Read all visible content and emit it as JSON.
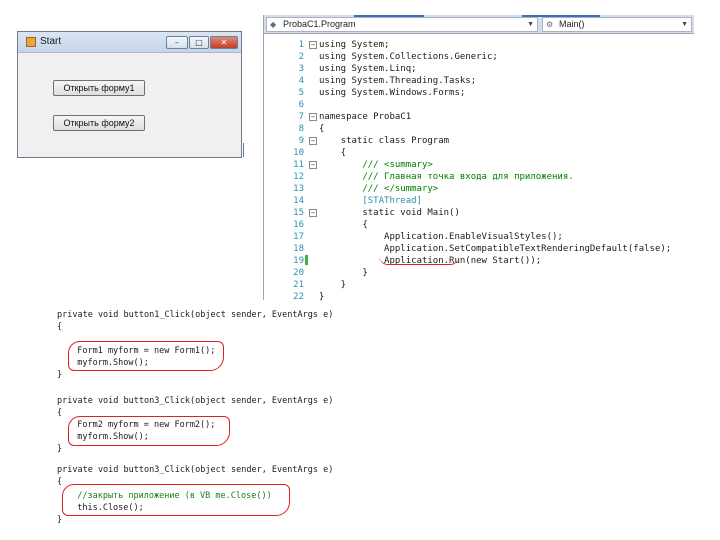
{
  "start_window": {
    "title": "Start",
    "button1": "Открыть форму1",
    "button2": "Открыть форму2"
  },
  "editor": {
    "class_combo": "ProbaC1.Program",
    "method_combo": "Main()",
    "lines": [
      {
        "no": "1",
        "text": "using System;"
      },
      {
        "no": "2",
        "text": "using System.Collections.Generic;"
      },
      {
        "no": "3",
        "text": "using System.Linq;"
      },
      {
        "no": "4",
        "text": "using System.Threading.Tasks;"
      },
      {
        "no": "5",
        "text": "using System.Windows.Forms;"
      },
      {
        "no": "6",
        "text": ""
      },
      {
        "no": "7",
        "text": "namespace ProbaC1"
      },
      {
        "no": "8",
        "text": "{"
      },
      {
        "no": "9",
        "text": "    static class Program"
      },
      {
        "no": "10",
        "text": "    {"
      },
      {
        "no": "11",
        "text": "        /// <summary>"
      },
      {
        "no": "12",
        "text": "        /// Главная точка входа для приложения."
      },
      {
        "no": "13",
        "text": "        /// </summary>"
      },
      {
        "no": "14",
        "text": "        [STAThread]"
      },
      {
        "no": "15",
        "text": "        static void Main()"
      },
      {
        "no": "16",
        "text": "        {"
      },
      {
        "no": "17",
        "text": "            Application.EnableVisualStyles();"
      },
      {
        "no": "18",
        "text": "            Application.SetCompatibleTextRenderingDefault(false);"
      },
      {
        "no": "19",
        "text": "            Application.Run(new Start());"
      },
      {
        "no": "20",
        "text": "        }"
      },
      {
        "no": "21",
        "text": "    }"
      },
      {
        "no": "22",
        "text": "}"
      }
    ]
  },
  "snippets": [
    {
      "header": "private void button1_Click(object sender, EventArgs e)",
      "open": "{",
      "body1": "  Form1 myform = new Form1();",
      "body2": "  myform.Show();",
      "close": "}"
    },
    {
      "header": "private void button3_Click(object sender, EventArgs e)",
      "open": "{",
      "body1": "  Form2 myform = new Form2();",
      "body2": "  myform.Show();",
      "close": "}"
    },
    {
      "header": "private void button3_Click(object sender, EventArgs e)",
      "open": "{",
      "body1": "  //закрыть приложение (в VB me.Close())",
      "body2": "  this.Close();",
      "close": "}"
    }
  ]
}
